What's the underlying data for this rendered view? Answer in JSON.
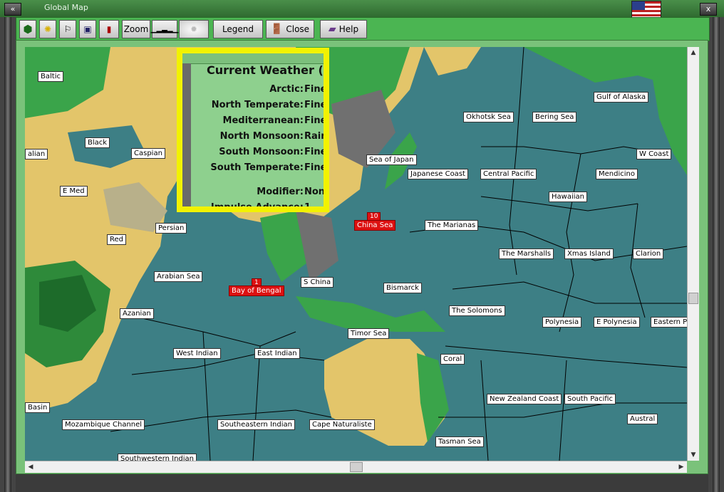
{
  "window": {
    "title": "Global Map",
    "close_glyph": "x",
    "min_glyph": "«"
  },
  "toolbar": {
    "zoom_label": "Zoom",
    "legend_label": "Legend",
    "close_label": "Close",
    "help_label": "Help"
  },
  "weather": {
    "title": "Current Weather (",
    "rows": [
      {
        "k": "Arctic:",
        "v": "Fine"
      },
      {
        "k": "North Temperate:",
        "v": "Fine"
      },
      {
        "k": "Mediterranean:",
        "v": "Fine"
      },
      {
        "k": "North Monsoon:",
        "v": "Rain"
      },
      {
        "k": "South Monsoon:",
        "v": "Fine"
      },
      {
        "k": "South Temperate:",
        "v": "Fine"
      },
      {
        "k": "Modifier:",
        "v": "None"
      },
      {
        "k": "Impulse Advance:",
        "v": "1"
      }
    ]
  },
  "sea_labels": {
    "baltic": "Baltic",
    "black": "Black",
    "italian": "alian",
    "caspian": "Caspian",
    "emed": "E Med",
    "red": "Red",
    "persian": "Persian",
    "arabian": "Arabian Sea",
    "azanian": "Azanian",
    "westindian": "West Indian",
    "eastindian": "East Indian",
    "basin": "Basin",
    "mozambique": "Mozambique Channel",
    "seindian": "Southeastern Indian",
    "swindian": "Southwestern Indian",
    "capenat": "Cape Naturaliste",
    "bengal": "Bay of Bengal",
    "schina": "S China",
    "chinasea": "China Sea",
    "timor": "Timor Sea",
    "bismarck": "Bismarck",
    "solomons": "The Solomons",
    "coral": "Coral",
    "tasman": "Tasman Sea",
    "nzcoast": "New Zealand Coast",
    "spacific": "South Pacific",
    "austral": "Austral",
    "seajapan": "Sea of Japan",
    "jpcoast": "Japanese Coast",
    "okhotsk": "Okhotsk Sea",
    "bering": "Bering Sea",
    "alaska": "Gulf of Alaska",
    "wcoast": "W Coast",
    "centralpac": "Central Pacific",
    "mendicino": "Mendicino",
    "hawaiian": "Hawaiian",
    "marianas": "The Marianas",
    "marshalls": "The Marshalls",
    "xmas": "Xmas Island",
    "clarion": "Clarion",
    "polynesia": "Polynesia",
    "epolynesia": "E Polynesia",
    "eastern": "Eastern P"
  },
  "badges": {
    "bengal": "1",
    "chinasea": "10"
  },
  "colors": {
    "sea": "#3d7f85",
    "land_desert": "#e3c56a",
    "land_green": "#3aa44a",
    "weather_border": "#f2f200",
    "ui_green": "#4bb552"
  }
}
